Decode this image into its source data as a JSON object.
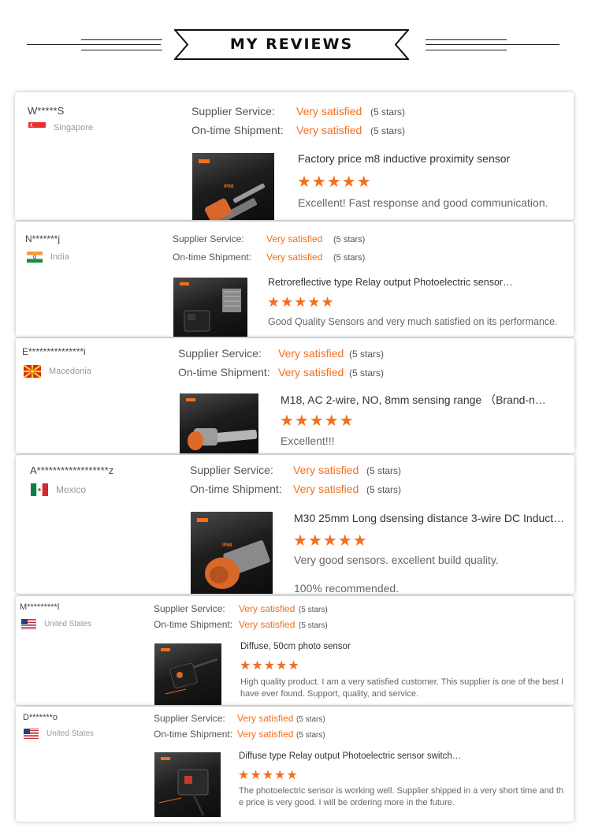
{
  "header": {
    "title": "MY REVIEWS"
  },
  "colors": {
    "accent": "#f36f1d",
    "muted": "#999999"
  },
  "labels": {
    "supplier": "Supplier Service:",
    "shipment": "On-time Shipment:"
  },
  "reviews": [
    {
      "user": "W*****S",
      "country": "Singapore",
      "flag": "singapore-flag",
      "supplier_rating": "Very satisfied",
      "supplier_stars": "(5 stars)",
      "shipment_rating": "Very satisfied",
      "shipment_stars": "(5 stars)",
      "product": "Factory price m8 inductive proximity sensor",
      "stars": "★★★★★",
      "star_count": 5,
      "thumb_tag": "IP68",
      "comment": "Excellent! Fast response and good communication."
    },
    {
      "user": "N*******j",
      "country": "India",
      "flag": "india-flag",
      "supplier_rating": "Very satisfied",
      "supplier_stars": "(5 stars)",
      "shipment_rating": "Very satisfied",
      "shipment_stars": "(5 stars)",
      "product": "Retroreflective type Relay output Photoelectric sensor…",
      "stars": "★★★★★",
      "star_count": 5,
      "thumb_tag": "",
      "comment": "Good Quality Sensors and very much satisfied on its performance."
    },
    {
      "user": "E***************i",
      "country": "Macedonia",
      "flag": "macedonia-flag",
      "supplier_rating": "Very satisfied",
      "supplier_stars": "(5 stars)",
      "shipment_rating": "Very satisfied",
      "shipment_stars": "(5 stars)",
      "product": "M18, AC 2-wire, NO, 8mm sensing range （Brand-new…",
      "stars": "★★★★★",
      "star_count": 5,
      "thumb_tag": "",
      "comment": "Excellent!!!"
    },
    {
      "user": "A******************z",
      "country": "Mexico",
      "flag": "mexico-flag",
      "supplier_rating": "Very satisfied",
      "supplier_stars": "(5 stars)",
      "shipment_rating": "Very satisfied",
      "shipment_stars": "(5 stars)",
      "product": "M30 25mm Long dsensing distance 3-wire DC Inducti…",
      "stars": "★★★★★",
      "star_count": 5,
      "thumb_tag": "IP68",
      "comment": "Very good sensors. excellent build quality.\n\n100% recommended."
    },
    {
      "user": "M*********l",
      "country": "United States",
      "flag": "us-flag",
      "supplier_rating": "Very satisfied",
      "supplier_stars": "(5 stars)",
      "shipment_rating": "Very satisfied",
      "shipment_stars": "(5 stars)",
      "product": "Diffuse, 50cm photo sensor",
      "stars": "★★★★★",
      "star_count": 5,
      "thumb_tag": "",
      "comment": "High quality product.  I am a very satisfied customer.  This supplier is one of the best I have ever found.  Support, quality, and service."
    },
    {
      "user": "D*******o",
      "country": "United States",
      "flag": "us-flag",
      "supplier_rating": "Very satisfied",
      "supplier_stars": "(5 stars)",
      "shipment_rating": "Very satisfied",
      "shipment_stars": "(5 stars)",
      "product": "Diffuse type Relay output Photoelectric sensor switch…",
      "stars": "★★★★★",
      "star_count": 5,
      "thumb_tag": "",
      "comment": "The photoelectric sensor is working well.  Supplier shipped in a very short time and the price is very good.  I will be ordering more in the future."
    }
  ]
}
